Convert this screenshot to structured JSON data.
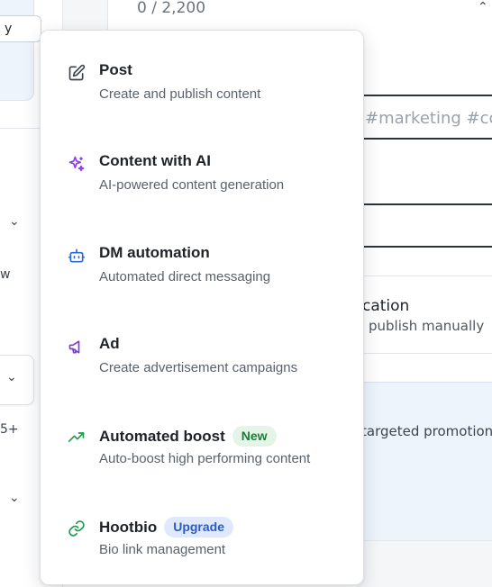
{
  "background": {
    "left_chip_label": "y",
    "left_text_1": "w",
    "left_text_2": "5+",
    "char_count": "0 / 2,200",
    "hashtag_placeholder": "#marketing #con",
    "option_title": "cation",
    "option_sub": "publish manually",
    "promo_text": "targeted promotion"
  },
  "menu": {
    "items": [
      {
        "title": "Post",
        "description": "Create and publish content",
        "icon": "edit-icon",
        "color": "#3d4450"
      },
      {
        "title": "Content with AI",
        "description": "AI-powered content generation",
        "icon": "sparkle-icon",
        "color": "#8a3ff0"
      },
      {
        "title": "DM automation",
        "description": "Automated direct messaging",
        "icon": "robot-icon",
        "color": "#2a6ad8"
      },
      {
        "title": "Ad",
        "description": "Create advertisement campaigns",
        "icon": "megaphone-icon",
        "color": "#7a3fd6"
      },
      {
        "title": "Automated boost",
        "description": "Auto-boost high performing content",
        "icon": "trending-up-icon",
        "color": "#1f9a4a",
        "badge": "New"
      },
      {
        "title": "Hootbio",
        "description": "Bio link management",
        "icon": "link-icon",
        "color": "#1f9a4a",
        "badge": "Upgrade"
      }
    ]
  },
  "colors": {
    "badge_new_bg": "#e4f5e8",
    "badge_new_text": "#1f7a3a",
    "badge_upgrade_bg": "#dfe9fb",
    "badge_upgrade_text": "#2a5bc7"
  }
}
